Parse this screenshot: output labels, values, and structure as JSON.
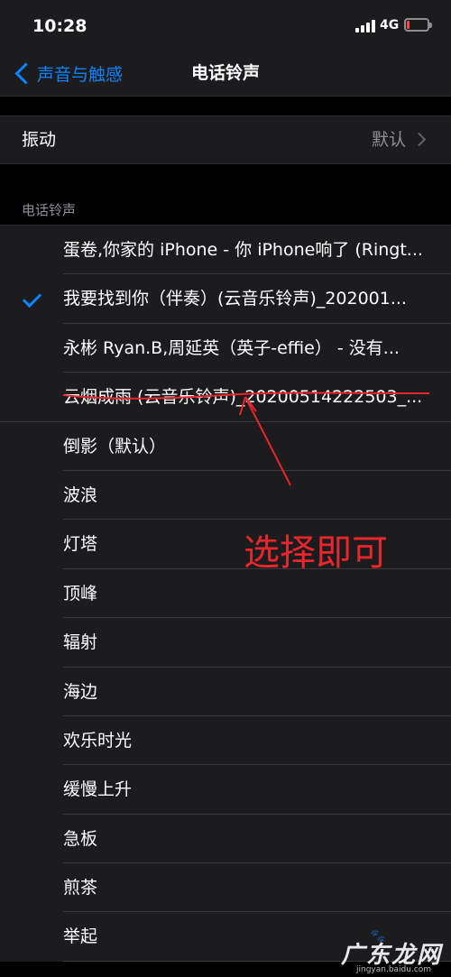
{
  "status_bar": {
    "time": "10:28",
    "network": "4G",
    "battery_level": 0.15,
    "battery_color": "#ff453a"
  },
  "nav": {
    "back_label": "声音与触感",
    "title": "电话铃声",
    "accent_color": "#0a84ff"
  },
  "vibration": {
    "label": "振动",
    "value": "默认"
  },
  "ringtones": {
    "header": "电话铃声",
    "selected_index": 1,
    "items": [
      {
        "label": "蛋卷,你家的 iPhone - 你 iPhone响了 (Ringt..."
      },
      {
        "label": "我要找到你（伴奏）(云音乐铃声)_202001..."
      },
      {
        "label": "永彬 Ryan.B,周延英（英子-effie） - 没有..."
      },
      {
        "label": "云烟成雨 (云音乐铃声)_20200514222503_..."
      },
      {
        "label": "倒影（默认）"
      },
      {
        "label": "波浪"
      },
      {
        "label": "灯塔"
      },
      {
        "label": "顶峰"
      },
      {
        "label": "辐射"
      },
      {
        "label": "海边"
      },
      {
        "label": "欢乐时光"
      },
      {
        "label": "缓慢上升"
      },
      {
        "label": "急板"
      },
      {
        "label": "煎茶"
      },
      {
        "label": "举起"
      }
    ]
  },
  "annotation": {
    "text": "选择即可",
    "color": "#e8262b"
  },
  "watermark": {
    "brand": "广东龙网",
    "sub": "jingyan.baidu.com"
  }
}
